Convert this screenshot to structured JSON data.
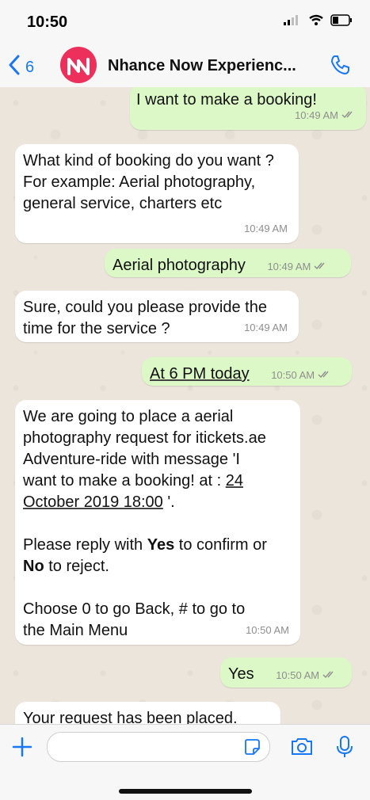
{
  "status_bar": {
    "time": "10:50"
  },
  "header": {
    "back_count": "6",
    "contact_name": "Nhance Now Experienc..."
  },
  "messages": [
    {
      "dir": "out",
      "text": "I want to make a booking!",
      "time": "10:49 AM",
      "status": "read"
    },
    {
      "dir": "in",
      "lines": [
        "What kind of booking do you want ?",
        "For example: Aerial photography,",
        "general service, charters etc"
      ],
      "time": "10:49 AM"
    },
    {
      "dir": "out",
      "text": "Aerial photography",
      "time": "10:49 AM",
      "status": "read"
    },
    {
      "dir": "in",
      "lines": [
        "Sure, could you please provide the",
        "time for the service ?"
      ],
      "time": "10:49 AM"
    },
    {
      "dir": "out",
      "text": "At 6 PM today",
      "time": "10:50 AM",
      "status": "read"
    },
    {
      "dir": "in",
      "lines": [
        "We are going to place a aerial",
        "photography request for itickets.ae",
        "Adventure-ride with message 'I",
        "want to make a booking! at :"
      ],
      "date_part1": "24",
      "date_part2": "October 2019 18:00",
      "date_tail": " '.",
      "confirm_prefix": "Please reply with ",
      "confirm_yes": "Yes",
      "confirm_middle": " to confirm or",
      "confirm_no": "No",
      "confirm_suffix": " to reject.",
      "choose_line1": "Choose  0 to go Back, # to go to",
      "choose_line2": "the Main Menu",
      "time": "10:50 AM"
    },
    {
      "dir": "out",
      "text": "Yes",
      "time": "10:50 AM",
      "status": "read"
    },
    {
      "dir": "in",
      "text": "Your request has been placed."
    }
  ],
  "composer": {
    "placeholder": ""
  },
  "colors": {
    "accent": "#1877f2",
    "outgoing_bubble": "#dcf8c6",
    "avatar": "#ec2f5b"
  }
}
